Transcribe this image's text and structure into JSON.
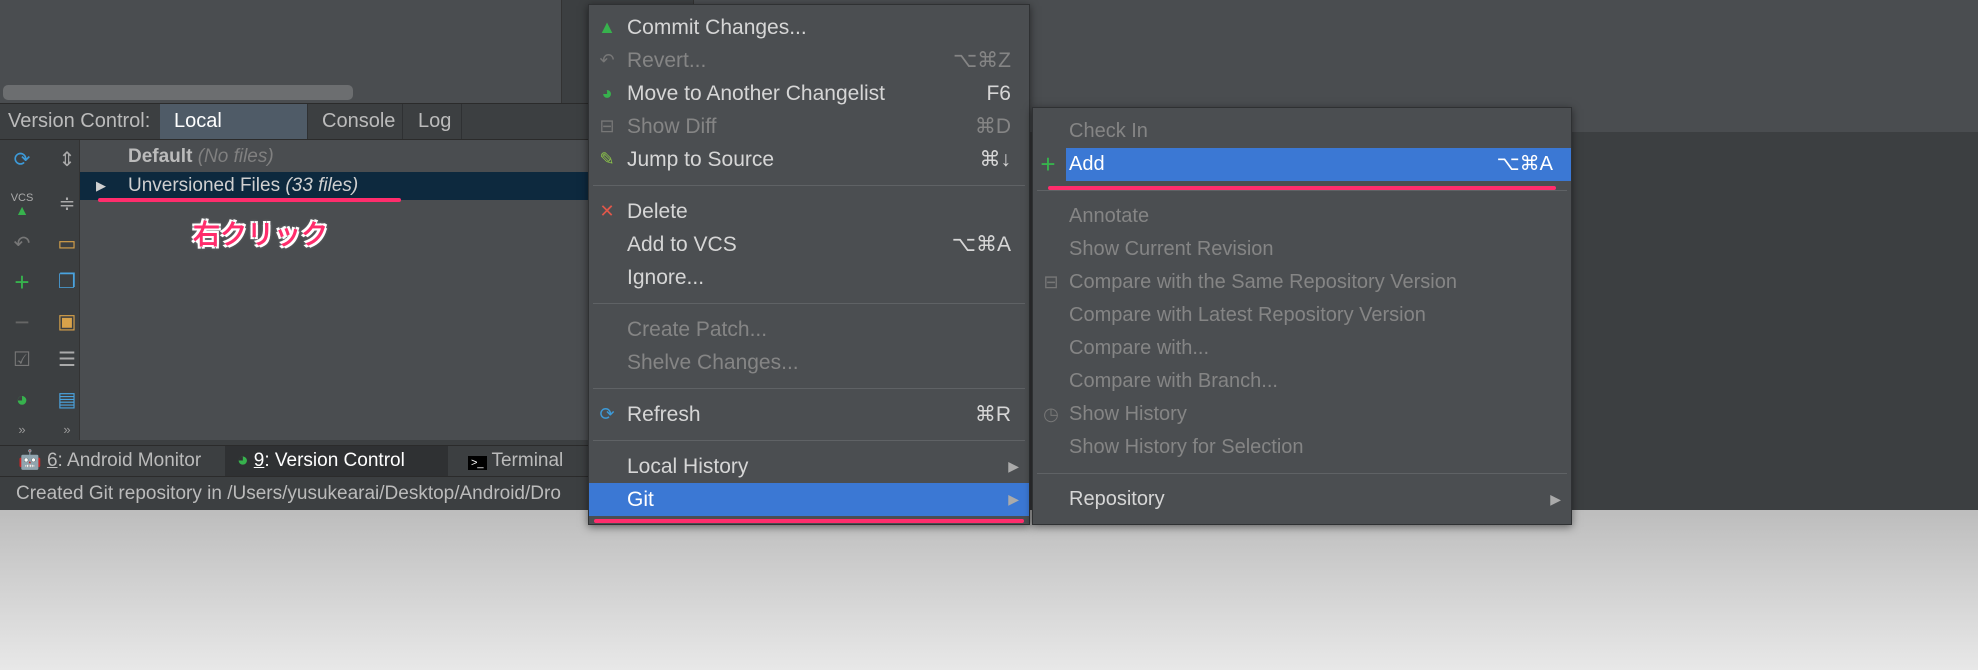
{
  "colors": {
    "highlight": "#3b78d4",
    "annotation": "#ff2d6c",
    "selected_row": "#0d293e",
    "add_icon": "#37b24d"
  },
  "panel": {
    "label": "Version Control:",
    "tabs": [
      {
        "label": "Local Changes",
        "active": true
      },
      {
        "label": "Console"
      },
      {
        "label": "Log"
      }
    ]
  },
  "tree": {
    "rows": [
      {
        "name": "Default",
        "detail": "(No files)"
      },
      {
        "name": "Unversioned Files",
        "detail": "(33 files)",
        "selected": true
      }
    ]
  },
  "annotation": "右クリック",
  "toolbar_icons": [
    "refresh-icon",
    "expand-all-icon",
    "commit-icon",
    "collapse-all-icon",
    "revert-icon",
    "group-icon",
    "add-icon",
    "copy-icon",
    "remove-icon",
    "preview-icon",
    "checkbox-icon",
    "checklist-icon",
    "move-changelist-icon",
    "details-icon",
    "more-icon",
    "more-icon"
  ],
  "bottom_tabs": [
    {
      "num": "6",
      "label": ": Android Monitor",
      "icon": "android-icon"
    },
    {
      "num": "9",
      "label": ": Version Control",
      "icon": "vcs-icon",
      "active": true
    },
    {
      "num": "",
      "label": "Terminal",
      "icon": "terminal-icon"
    }
  ],
  "status": "Created Git repository in /Users/yusukearai/Desktop/Android/Dro",
  "context_menu": {
    "items": [
      {
        "label": "Commit Changes...",
        "shortcut": "",
        "icon": "vcs-commit-icon"
      },
      {
        "label": "Revert...",
        "shortcut": "⌥⌘Z",
        "icon": "revert-icon",
        "disabled": true
      },
      {
        "label": "Move to Another Changelist",
        "shortcut": "F6",
        "icon": "move-changelist-icon"
      },
      {
        "label": "Show Diff",
        "shortcut": "⌘D",
        "icon": "diff-icon",
        "disabled": true
      },
      {
        "label": "Jump to Source",
        "shortcut": "⌘↓",
        "icon": "edit-source-icon"
      },
      {
        "sep": true
      },
      {
        "label": "Delete",
        "shortcut": "",
        "icon": "delete-icon"
      },
      {
        "label": "Add to VCS",
        "shortcut": "⌥⌘A"
      },
      {
        "label": "Ignore..."
      },
      {
        "sep": true
      },
      {
        "label": "Create Patch...",
        "disabled": true
      },
      {
        "label": "Shelve Changes...",
        "disabled": true
      },
      {
        "sep": true
      },
      {
        "label": "Refresh",
        "shortcut": "⌘R",
        "icon": "refresh-icon"
      },
      {
        "sep": true
      },
      {
        "label": "Local History",
        "submenu": true
      },
      {
        "label": "Git",
        "submenu": true,
        "highlighted": true
      }
    ]
  },
  "git_submenu": {
    "items": [
      {
        "label": "Check In",
        "disabled": true
      },
      {
        "label": "Add",
        "shortcut": "⌥⌘A",
        "icon": "add-icon",
        "highlighted": true
      },
      {
        "sep": true
      },
      {
        "label": "Annotate",
        "disabled": true
      },
      {
        "label": "Show Current Revision",
        "disabled": true
      },
      {
        "label": "Compare with the Same Repository Version",
        "disabled": true,
        "icon": "diff-icon"
      },
      {
        "label": "Compare with Latest Repository Version",
        "disabled": true
      },
      {
        "label": "Compare with...",
        "disabled": true
      },
      {
        "label": "Compare with Branch...",
        "disabled": true
      },
      {
        "label": "Show History",
        "disabled": true,
        "icon": "history-icon"
      },
      {
        "label": "Show History for Selection",
        "disabled": true
      },
      {
        "sep": true
      },
      {
        "label": "Repository",
        "submenu": true
      }
    ]
  }
}
